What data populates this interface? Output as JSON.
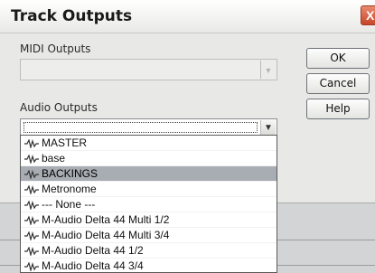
{
  "dialog": {
    "title": "Track Outputs",
    "close_glyph": "X"
  },
  "midi": {
    "label": "MIDI Outputs",
    "value": "",
    "dropdown_icon": "chevron-down-icon"
  },
  "audio": {
    "label": "Audio Outputs",
    "value": "",
    "dropdown_icon": "chevron-down-icon",
    "options": [
      {
        "label": "MASTER",
        "icon": "audio-wave-icon",
        "selected": false
      },
      {
        "label": "base",
        "icon": "audio-wave-icon",
        "selected": false
      },
      {
        "label": "BACKINGS",
        "icon": "audio-wave-icon",
        "selected": true
      },
      {
        "label": "Metronome",
        "icon": "audio-wave-icon",
        "selected": false
      },
      {
        "label": "--- None ---",
        "icon": "audio-wave-icon",
        "selected": false
      },
      {
        "label": "M-Audio Delta 44 Multi 1/2",
        "icon": "audio-wave-icon",
        "selected": false
      },
      {
        "label": "M-Audio Delta 44 Multi 3/4",
        "icon": "audio-wave-icon",
        "selected": false
      },
      {
        "label": "M-Audio Delta 44 1/2",
        "icon": "audio-wave-icon",
        "selected": false
      },
      {
        "label": "M-Audio Delta 44 3/4",
        "icon": "audio-wave-icon",
        "selected": false
      }
    ]
  },
  "buttons": {
    "ok": "OK",
    "cancel": "Cancel",
    "help": "Help"
  },
  "colors": {
    "close_button": "#c7462a",
    "selected_row": "#a8acb3"
  }
}
